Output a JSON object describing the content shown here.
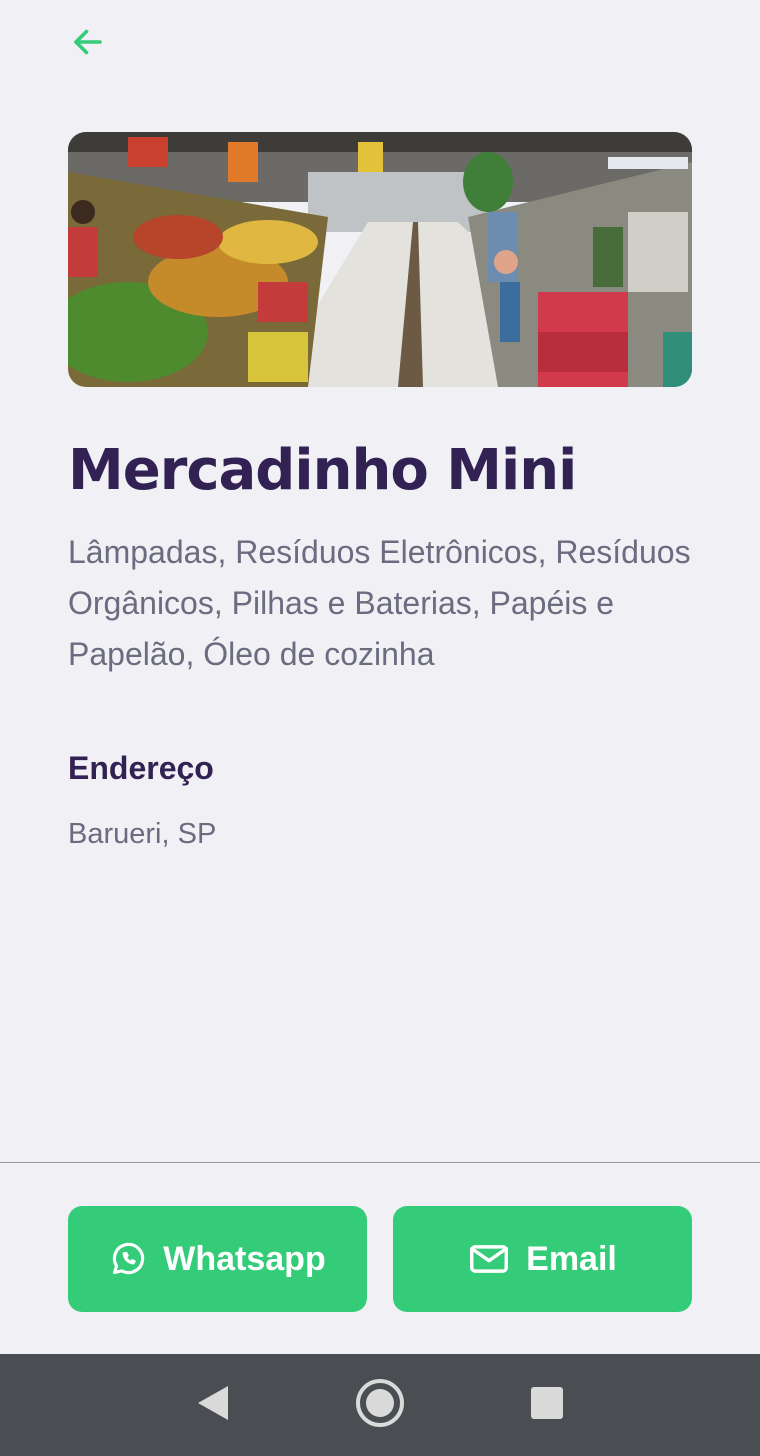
{
  "header": {
    "back_icon": "arrow-left-icon",
    "accent_color": "#34CB79"
  },
  "point": {
    "image_alt": "Mercado com bancas de frutas",
    "name": "Mercadinho Mini",
    "items": "Lâmpadas, Resíduos Eletrônicos, Resíduos Orgânicos, Pilhas e Baterias, Papéis e Papelão, Óleo de cozinha"
  },
  "address": {
    "title": "Endereço",
    "value": "Barueri, SP"
  },
  "footer": {
    "whatsapp_label": "Whatsapp",
    "whatsapp_icon": "whatsapp-icon",
    "email_label": "Email",
    "email_icon": "mail-icon"
  },
  "navbar": {
    "back_icon": "nav-back-icon",
    "home_icon": "nav-home-icon",
    "recents_icon": "nav-recents-icon"
  },
  "colors": {
    "title": "#322153",
    "text": "#6C6C80",
    "button": "#34CB79",
    "background": "#F0F0F5"
  }
}
